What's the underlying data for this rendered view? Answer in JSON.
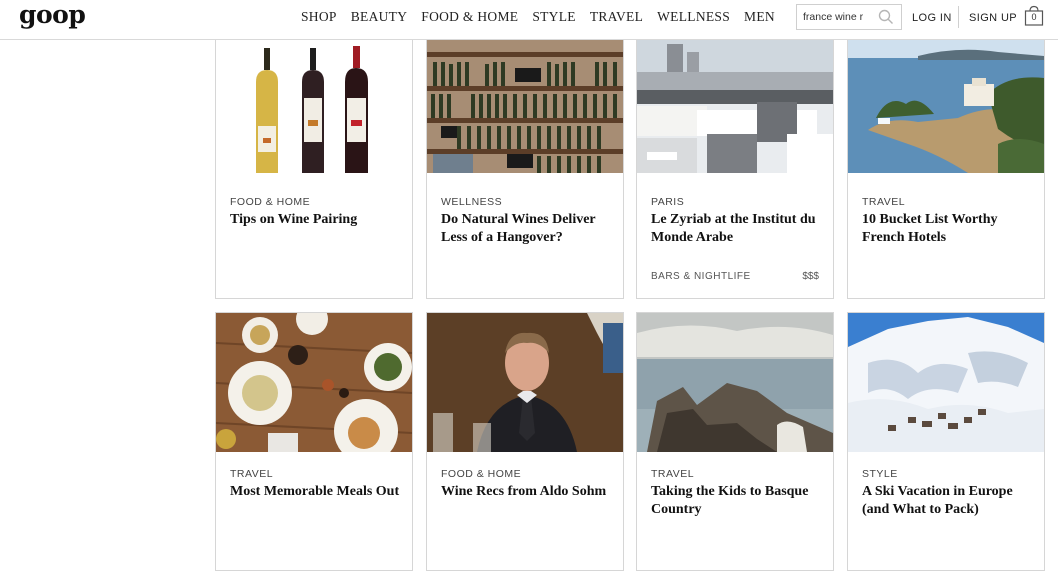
{
  "header": {
    "logo": "goop",
    "nav": [
      "SHOP",
      "BEAUTY",
      "FOOD & HOME",
      "STYLE",
      "TRAVEL",
      "WELLNESS",
      "MEN"
    ],
    "search_value": "france wine r",
    "login": "LOG IN",
    "signup": "SIGN UP",
    "bag_count": "0"
  },
  "cards": [
    {
      "category": "FOOD & HOME",
      "title": "Tips on Wine Pairing",
      "image": "wine-bottles-image"
    },
    {
      "category": "WELLNESS",
      "title": "Do Natural Wines Deliver Less of a Hangover?",
      "image": "wine-shelves-image"
    },
    {
      "category": "PARIS",
      "title": "Le Zyriab at the Institut du Monde Arabe",
      "tag": "BARS & NIGHTLIFE",
      "price": "$$$",
      "image": "rooftop-restaurant-image"
    },
    {
      "category": "TRAVEL",
      "title": "10 Bucket List Worthy French Hotels",
      "image": "coastal-hotel-image"
    },
    {
      "category": "TRAVEL",
      "title": "Most Memorable Meals Out",
      "image": "dinner-table-image"
    },
    {
      "category": "FOOD & HOME",
      "title": "Wine Recs from Aldo Sohm",
      "image": "sommelier-portrait-image"
    },
    {
      "category": "TRAVEL",
      "title": "Taking the Kids to Basque Country",
      "image": "rocky-coast-image"
    },
    {
      "category": "STYLE",
      "title": "A Ski Vacation in Europe (and What to Pack)",
      "image": "snowy-mountains-image"
    }
  ],
  "colors": {
    "border": "#d6d6d6",
    "text": "#111111",
    "category": "#444444"
  }
}
